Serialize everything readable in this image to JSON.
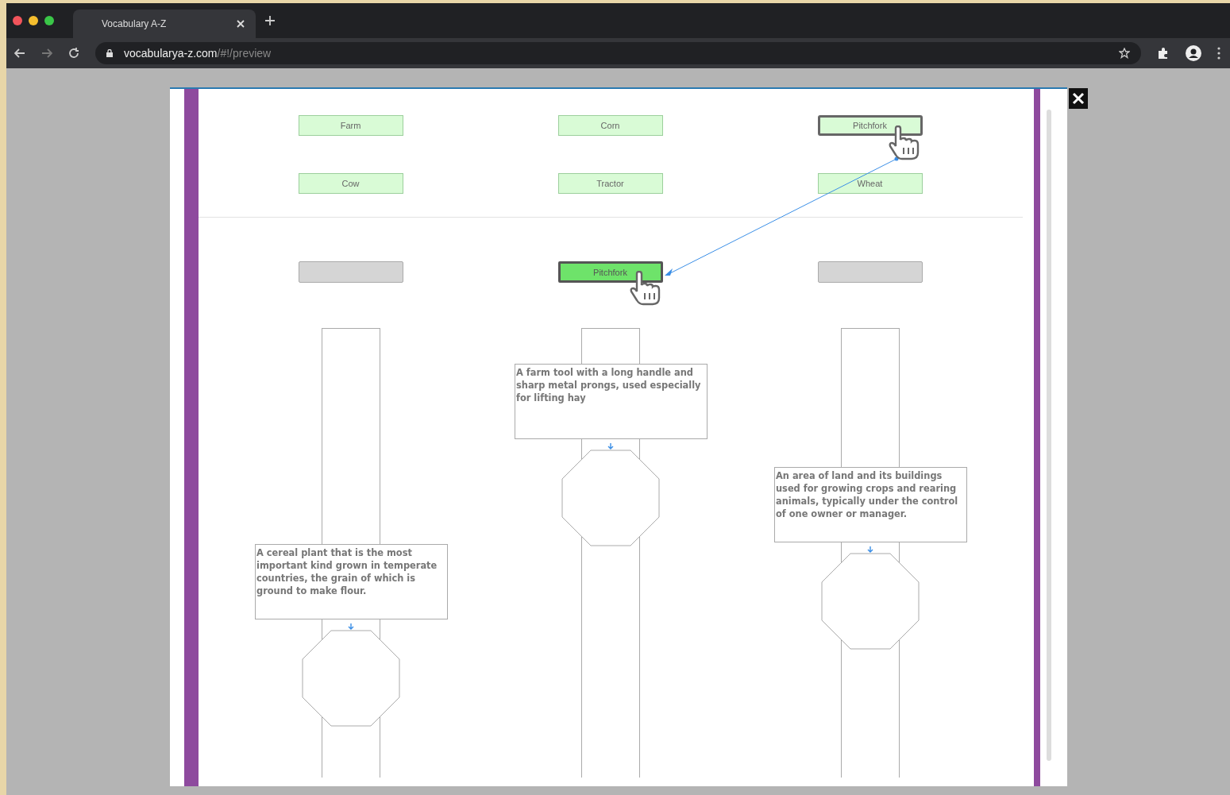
{
  "browser": {
    "tab_title": "Vocabulary A-Z",
    "url_host": "vocabularya-z.com",
    "url_path": "/#!/preview"
  },
  "word_rows": [
    [
      {
        "label": "Farm",
        "selected": false
      },
      {
        "label": "Corn",
        "selected": false
      },
      {
        "label": "Pitchfork",
        "selected": true
      }
    ],
    [
      {
        "label": "Cow",
        "selected": false
      },
      {
        "label": "Tractor",
        "selected": false
      },
      {
        "label": "Wheat",
        "selected": false
      }
    ]
  ],
  "lanes": [
    {
      "slot": {
        "filled": false
      },
      "definition": "A cereal plant that is the most important kind grown in temperate countries, the grain of which is ground to make flour."
    },
    {
      "slot": {
        "filled": true,
        "word": "Pitchfork"
      },
      "definition": "A farm tool with a long handle and sharp metal prongs, used especially for lifting hay"
    },
    {
      "slot": {
        "filled": false
      },
      "definition": "An area of land and its buildings used for growing crops and rearing animals, typically under the control of one owner or manager."
    }
  ]
}
